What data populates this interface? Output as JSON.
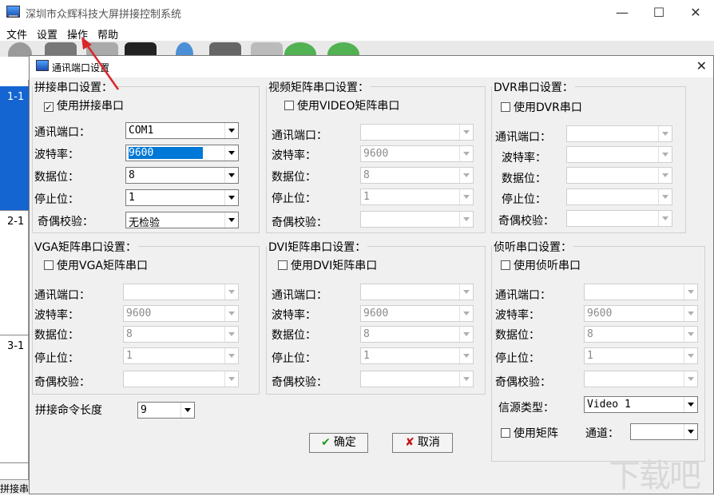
{
  "window": {
    "title": "深圳市众辉科技大屏拼接控制系统",
    "minimize": "—",
    "maximize": "☐",
    "close": "✕"
  },
  "menu": [
    "文件",
    "设置",
    "操作",
    "帮助"
  ],
  "side": [
    "1-1",
    "2-1",
    "3-1"
  ],
  "status": "拼接串",
  "dialog": {
    "title": "通讯端口设置",
    "close": "✕",
    "labels": {
      "port": "通讯端口：",
      "baud": "波特率：",
      "databits": "数据位：",
      "stopbits": "停止位：",
      "parity": "奇偶校验："
    },
    "splice": {
      "legend": "拼接串口设置：",
      "use": "使用拼接串口",
      "checked": true,
      "port": "COM1",
      "baud": "9600",
      "databits": "8",
      "stopbits": "1",
      "parity": "无检验"
    },
    "video": {
      "legend": "视频矩阵串口设置：",
      "use": "使用VIDEO矩阵串口",
      "baud": "9600",
      "databits": "8",
      "stopbits": "1"
    },
    "dvr": {
      "legend": "DVR串口设置：",
      "use": "使用DVR串口"
    },
    "vga": {
      "legend": "VGA矩阵串口设置：",
      "use": "使用VGA矩阵串口",
      "baud": "9600",
      "databits": "8",
      "stopbits": "1"
    },
    "dvi": {
      "legend": "DVI矩阵串口设置：",
      "use": "使用DVI矩阵串口",
      "baud": "9600",
      "databits": "8",
      "stopbits": "1"
    },
    "listen": {
      "legend": "侦听串口设置：",
      "use": "使用侦听串口",
      "baud": "9600",
      "databits": "8",
      "stopbits": "1",
      "source_label": "信源类型：",
      "source": "Video 1",
      "matrix": "使用矩阵",
      "channel_label": "通道："
    },
    "cmd_length_label": "拼接命令长度",
    "cmd_length": "9",
    "ok": "确定",
    "cancel": "取消"
  },
  "watermark": "下载吧",
  "colors": {
    "accent": "#0078d7",
    "arrow": "#d9262c",
    "ok": "#1f9a1f",
    "cancel": "#c81414"
  }
}
